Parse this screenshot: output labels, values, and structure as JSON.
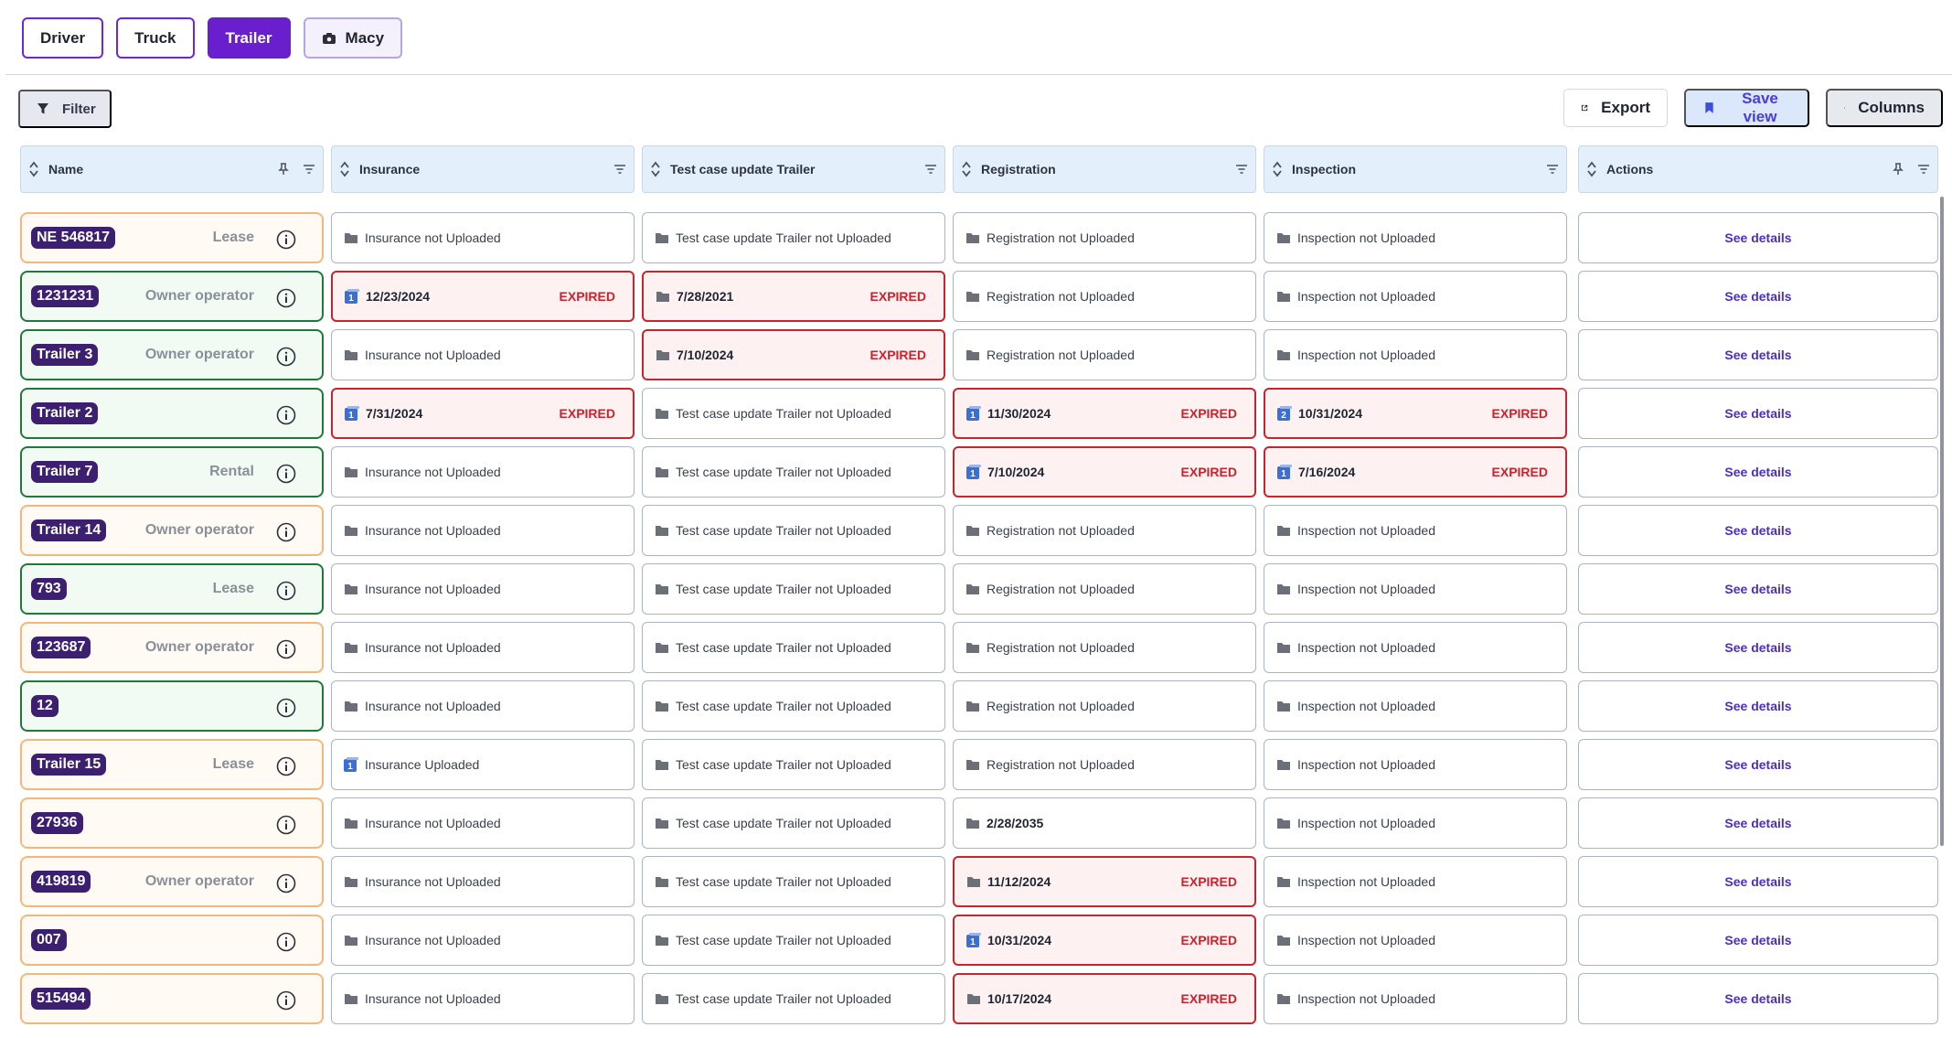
{
  "tabs": [
    {
      "label": "Driver",
      "active": false
    },
    {
      "label": "Truck",
      "active": false
    },
    {
      "label": "Trailer",
      "active": true
    },
    {
      "label": "Macy",
      "active": false,
      "icon": "user-card-icon"
    }
  ],
  "toolbar": {
    "filter_label": "Filter",
    "export_label": "Export",
    "save_view_label": "Save view",
    "columns_label": "Columns"
  },
  "columns": [
    {
      "label": "Name",
      "pin": true,
      "filter": true
    },
    {
      "label": "Insurance",
      "pin": false,
      "filter": true
    },
    {
      "label": "Test case update Trailer",
      "pin": false,
      "filter": true
    },
    {
      "label": "Registration",
      "pin": false,
      "filter": true
    },
    {
      "label": "Inspection",
      "pin": false,
      "filter": true
    },
    {
      "label": "Actions",
      "pin": true,
      "filter": true
    }
  ],
  "colors": {
    "accent": "#6a1fcf",
    "expired": "#c7242e",
    "orange_border": "#f5b779",
    "green_border": "#1e7a3a",
    "link": "#4a2fc2",
    "name_pill": "#3c1f6e"
  },
  "expired_label": "EXPIRED",
  "rows": [
    {
      "name": "NE 546817",
      "type": "Lease",
      "status": "orange",
      "insurance": {
        "text": "Insurance not Uploaded",
        "expired": false,
        "icon": "folder"
      },
      "test": {
        "text": "Test case update Trailer not Uploaded",
        "expired": false,
        "icon": "folder"
      },
      "registration": {
        "text": "Registration not Uploaded",
        "expired": false,
        "icon": "folder"
      },
      "inspection": {
        "text": "Inspection not Uploaded",
        "expired": false,
        "icon": "folder"
      },
      "action": "See details"
    },
    {
      "name": "1231231",
      "type": "Owner operator",
      "status": "green",
      "insurance": {
        "text": "12/23/2024",
        "expired": true,
        "icon": "badge",
        "badge": "1"
      },
      "test": {
        "text": "7/28/2021",
        "expired": true,
        "icon": "folder"
      },
      "registration": {
        "text": "Registration not Uploaded",
        "expired": false,
        "icon": "folder"
      },
      "inspection": {
        "text": "Inspection not Uploaded",
        "expired": false,
        "icon": "folder"
      },
      "action": "See details"
    },
    {
      "name": "Trailer 3",
      "type": "Owner operator",
      "status": "green",
      "insurance": {
        "text": "Insurance not Uploaded",
        "expired": false,
        "icon": "folder"
      },
      "test": {
        "text": "7/10/2024",
        "expired": true,
        "icon": "folder"
      },
      "registration": {
        "text": "Registration not Uploaded",
        "expired": false,
        "icon": "folder"
      },
      "inspection": {
        "text": "Inspection not Uploaded",
        "expired": false,
        "icon": "folder"
      },
      "action": "See details"
    },
    {
      "name": "Trailer 2",
      "type": "",
      "status": "green",
      "insurance": {
        "text": "7/31/2024",
        "expired": true,
        "icon": "badge",
        "badge": "1"
      },
      "test": {
        "text": "Test case update Trailer not Uploaded",
        "expired": false,
        "icon": "folder"
      },
      "registration": {
        "text": "11/30/2024",
        "expired": true,
        "icon": "badge",
        "badge": "1"
      },
      "inspection": {
        "text": "10/31/2024",
        "expired": true,
        "icon": "badge",
        "badge": "2"
      },
      "action": "See details"
    },
    {
      "name": "Trailer 7",
      "type": "Rental",
      "status": "green",
      "insurance": {
        "text": "Insurance not Uploaded",
        "expired": false,
        "icon": "folder"
      },
      "test": {
        "text": "Test case update Trailer not Uploaded",
        "expired": false,
        "icon": "folder"
      },
      "registration": {
        "text": "7/10/2024",
        "expired": true,
        "icon": "badge",
        "badge": "1"
      },
      "inspection": {
        "text": "7/16/2024",
        "expired": true,
        "icon": "badge",
        "badge": "1"
      },
      "action": "See details"
    },
    {
      "name": "Trailer 14",
      "type": "Owner operator",
      "status": "orange",
      "insurance": {
        "text": "Insurance not Uploaded",
        "expired": false,
        "icon": "folder"
      },
      "test": {
        "text": "Test case update Trailer not Uploaded",
        "expired": false,
        "icon": "folder"
      },
      "registration": {
        "text": "Registration not Uploaded",
        "expired": false,
        "icon": "folder"
      },
      "inspection": {
        "text": "Inspection not Uploaded",
        "expired": false,
        "icon": "folder"
      },
      "action": "See details"
    },
    {
      "name": "793",
      "type": "Lease",
      "status": "green",
      "insurance": {
        "text": "Insurance not Uploaded",
        "expired": false,
        "icon": "folder"
      },
      "test": {
        "text": "Test case update Trailer not Uploaded",
        "expired": false,
        "icon": "folder"
      },
      "registration": {
        "text": "Registration not Uploaded",
        "expired": false,
        "icon": "folder"
      },
      "inspection": {
        "text": "Inspection not Uploaded",
        "expired": false,
        "icon": "folder"
      },
      "action": "See details"
    },
    {
      "name": "123687",
      "type": "Owner operator",
      "status": "orange",
      "insurance": {
        "text": "Insurance not Uploaded",
        "expired": false,
        "icon": "folder"
      },
      "test": {
        "text": "Test case update Trailer not Uploaded",
        "expired": false,
        "icon": "folder"
      },
      "registration": {
        "text": "Registration not Uploaded",
        "expired": false,
        "icon": "folder"
      },
      "inspection": {
        "text": "Inspection not Uploaded",
        "expired": false,
        "icon": "folder"
      },
      "action": "See details"
    },
    {
      "name": "12",
      "type": "",
      "status": "green",
      "insurance": {
        "text": "Insurance not Uploaded",
        "expired": false,
        "icon": "folder"
      },
      "test": {
        "text": "Test case update Trailer not Uploaded",
        "expired": false,
        "icon": "folder"
      },
      "registration": {
        "text": "Registration not Uploaded",
        "expired": false,
        "icon": "folder"
      },
      "inspection": {
        "text": "Inspection not Uploaded",
        "expired": false,
        "icon": "folder"
      },
      "action": "See details"
    },
    {
      "name": "Trailer 15",
      "type": "Lease",
      "status": "orange",
      "insurance": {
        "text": "Insurance  Uploaded",
        "expired": false,
        "icon": "badge",
        "badge": "1"
      },
      "test": {
        "text": "Test case update Trailer not Uploaded",
        "expired": false,
        "icon": "folder"
      },
      "registration": {
        "text": "Registration not Uploaded",
        "expired": false,
        "icon": "folder"
      },
      "inspection": {
        "text": "Inspection not Uploaded",
        "expired": false,
        "icon": "folder"
      },
      "action": "See details"
    },
    {
      "name": "27936",
      "type": "",
      "status": "orange",
      "insurance": {
        "text": "Insurance not Uploaded",
        "expired": false,
        "icon": "folder"
      },
      "test": {
        "text": "Test case update Trailer not Uploaded",
        "expired": false,
        "icon": "folder"
      },
      "registration": {
        "text": "2/28/2035",
        "expired": false,
        "icon": "folder",
        "date": true
      },
      "inspection": {
        "text": "Inspection not Uploaded",
        "expired": false,
        "icon": "folder"
      },
      "action": "See details"
    },
    {
      "name": "419819",
      "type": "Owner operator",
      "status": "orange",
      "insurance": {
        "text": "Insurance not Uploaded",
        "expired": false,
        "icon": "folder"
      },
      "test": {
        "text": "Test case update Trailer not Uploaded",
        "expired": false,
        "icon": "folder"
      },
      "registration": {
        "text": "11/12/2024",
        "expired": true,
        "icon": "folder"
      },
      "inspection": {
        "text": "Inspection not Uploaded",
        "expired": false,
        "icon": "folder"
      },
      "action": "See details"
    },
    {
      "name": "007",
      "type": "",
      "status": "orange",
      "insurance": {
        "text": "Insurance not Uploaded",
        "expired": false,
        "icon": "folder"
      },
      "test": {
        "text": "Test case update Trailer not Uploaded",
        "expired": false,
        "icon": "folder"
      },
      "registration": {
        "text": "10/31/2024",
        "expired": true,
        "icon": "badge",
        "badge": "1"
      },
      "inspection": {
        "text": "Inspection not Uploaded",
        "expired": false,
        "icon": "folder"
      },
      "action": "See details"
    },
    {
      "name": "515494",
      "type": "",
      "status": "orange",
      "insurance": {
        "text": "Insurance not Uploaded",
        "expired": false,
        "icon": "folder"
      },
      "test": {
        "text": "Test case update Trailer not Uploaded",
        "expired": false,
        "icon": "folder"
      },
      "registration": {
        "text": "10/17/2024",
        "expired": true,
        "icon": "folder"
      },
      "inspection": {
        "text": "Inspection not Uploaded",
        "expired": false,
        "icon": "folder"
      },
      "action": "See details"
    }
  ]
}
